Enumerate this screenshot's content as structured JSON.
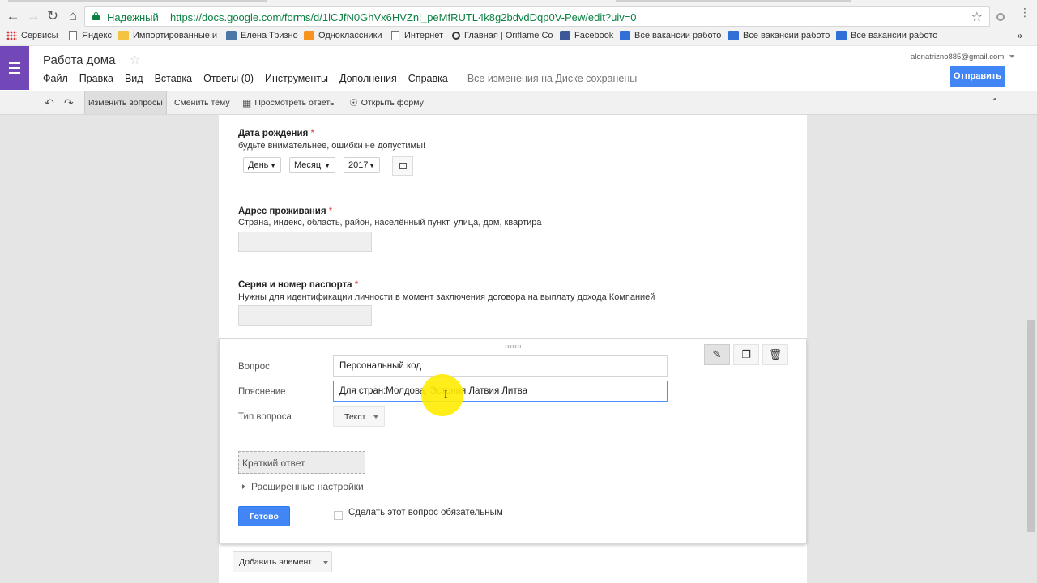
{
  "browser": {
    "secure_label": "Надежный",
    "url": "https://docs.google.com/forms/d/1lCJfN0GhVx6HVZnl_peMfRUTL4k8g2bdvdDqp0V-Pew/edit?uiv=0"
  },
  "bookmarks": [
    {
      "label": "Сервисы",
      "icon": "apps-icon"
    },
    {
      "label": "Яндекс",
      "icon": "page-icon"
    },
    {
      "label": "Импортированные и",
      "icon": "folder-icon"
    },
    {
      "label": "Елена Тризно",
      "icon": "vk-icon"
    },
    {
      "label": "Одноклассники",
      "icon": "ok-icon"
    },
    {
      "label": "Интернет",
      "icon": "page-icon"
    },
    {
      "label": "Главная | Oriflame Co",
      "icon": "oriflame-icon"
    },
    {
      "label": "Facebook",
      "icon": "facebook-icon"
    },
    {
      "label": "Все вакансии работо",
      "icon": "folder-icon"
    },
    {
      "label": "Все вакансии работо",
      "icon": "folder-icon"
    },
    {
      "label": "Все вакансии работо",
      "icon": "folder-icon"
    }
  ],
  "bookmarks_more": "»",
  "form_header": {
    "title": "Работа дома",
    "menu": [
      "Файл",
      "Правка",
      "Вид",
      "Вставка",
      "Ответы (0)",
      "Инструменты",
      "Дополнения",
      "Справка"
    ],
    "saved_status": "Все изменения на Диске сохранены",
    "account": "alenatrizno885@gmail.com",
    "send_label": "Отправить"
  },
  "toolbar": {
    "edit_questions": "Изменить вопросы",
    "change_theme": "Сменить тему",
    "view_responses": "Просмотреть ответы",
    "open_form": "Открыть форму"
  },
  "questions": {
    "birthdate": {
      "title": "Дата рождения",
      "required_mark": "*",
      "help": "будьте внимательнее, ошибки не допустимы!",
      "day": "День",
      "month": "Месяц",
      "year": "2017"
    },
    "address": {
      "title": "Адрес проживания",
      "required_mark": "*",
      "help": "Страна, индекс, область, район, населённый пункт, улица, дом, квартира"
    },
    "passport": {
      "title": "Серия и номер паспорта",
      "required_mark": "*",
      "help": "Нужны для идентификации личности в момент заключения договора на выплату дохода Компанией"
    }
  },
  "editor": {
    "question_label": "Вопрос",
    "question_value": "Персональный код",
    "help_label": "Пояснение",
    "help_value": "Для стран:Молдова, Эстония Латвия Литва",
    "type_label": "Тип вопроса",
    "type_value": "Текст",
    "short_answer": "Краткий ответ",
    "advanced": "Расширенные настройки",
    "done_label": "Готово",
    "required_label": "Сделать этот вопрос обязательным",
    "required_checked": false
  },
  "add_item_label": "Добавить элемент"
}
